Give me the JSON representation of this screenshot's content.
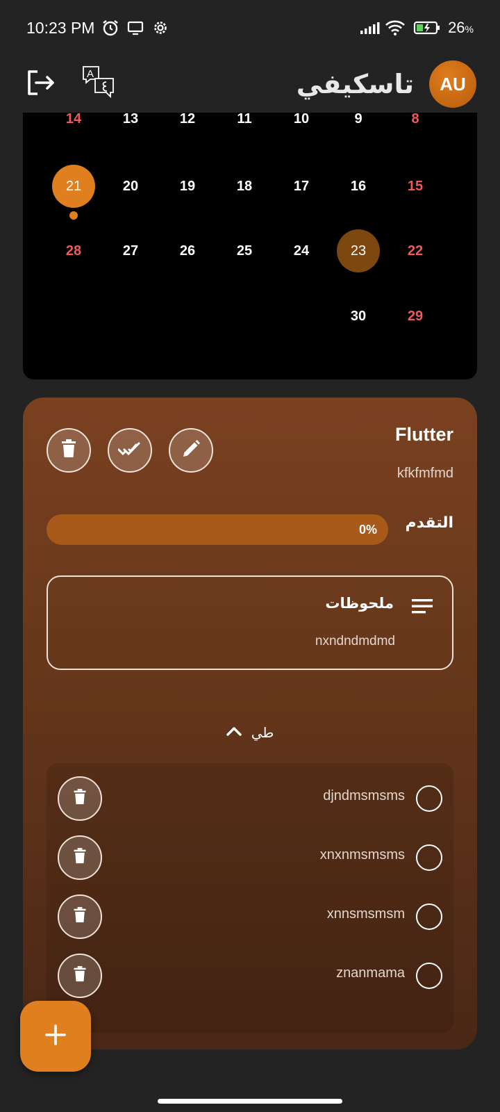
{
  "status_bar": {
    "time": "10:23 PM",
    "battery_percent": "26",
    "battery_unit": "%",
    "icons": [
      "alarm-icon",
      "screen-cast-icon",
      "settings-icon",
      "signal-icon",
      "wifi-icon",
      "battery-charging-icon"
    ]
  },
  "app_bar": {
    "title": "تاسكيفي",
    "avatar_initials": "AU",
    "icons": [
      "logout-icon",
      "translate-icon"
    ]
  },
  "calendar": {
    "rows": [
      [
        "14",
        "13",
        "12",
        "11",
        "10",
        "9",
        "8"
      ],
      [
        "21",
        "20",
        "19",
        "18",
        "17",
        "16",
        "15"
      ],
      [
        "28",
        "27",
        "26",
        "25",
        "24",
        "23",
        "22"
      ],
      [
        "",
        "",
        "",
        "",
        "",
        "30",
        "29"
      ]
    ],
    "today": "21",
    "selected": "23"
  },
  "task": {
    "title": "Flutter",
    "description": "kfkfmfmd",
    "progress_label": "التقدم",
    "progress_value": 0,
    "progress_text": "0%",
    "notes_title": "ملحوظات",
    "notes_text": "nxndndmdmd",
    "collapse_label": "طي",
    "subtasks": [
      {
        "label": "djndmsmsms",
        "done": false
      },
      {
        "label": "xnxnmsmsms",
        "done": false
      },
      {
        "label": "xnnsmsmsm",
        "done": false
      },
      {
        "label": "znanmama",
        "done": false
      }
    ]
  },
  "colors": {
    "accent": "#df7f1f",
    "weekend": "#f05a5a",
    "selected_day": "#7d4710",
    "card_top": "#7a4120",
    "card_bottom": "#4a2716"
  }
}
